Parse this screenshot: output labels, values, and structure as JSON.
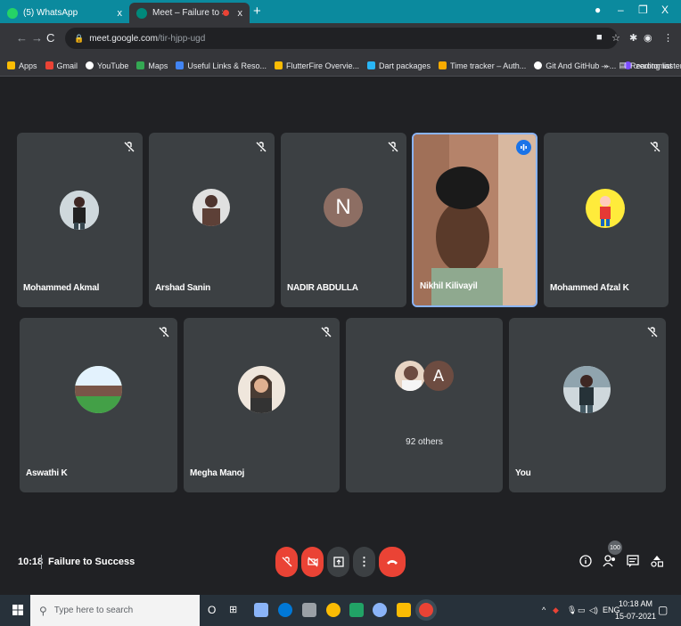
{
  "browser": {
    "tabs": [
      {
        "title": "(5) WhatsApp",
        "close": "x"
      },
      {
        "title": "Meet – Failure to Success",
        "close": "x"
      }
    ],
    "new_tab": "+",
    "url_host": "meet.google.com",
    "url_path": "/tir-hjpp-ugd",
    "bookmarks": [
      {
        "label": "Apps",
        "color": "#fbbc04"
      },
      {
        "label": "Gmail",
        "color": "#ea4335"
      },
      {
        "label": "YouTube",
        "color": "#ffffff"
      },
      {
        "label": "Maps",
        "color": "#34a853"
      },
      {
        "label": "Useful Links & Reso...",
        "color": "#4285f4"
      },
      {
        "label": "FlutterFire Overvie...",
        "color": "#fbbc04"
      },
      {
        "label": "Dart packages",
        "color": "#29b6f6"
      },
      {
        "label": "Time tracker – Auth...",
        "color": "#f9ab00"
      },
      {
        "label": "Git And GitHub —...",
        "color": "#ffffff"
      },
      {
        "label": "zerotomastery.io",
        "color": "#7c4dff"
      }
    ],
    "reading_list": "Reading list",
    "more": "»"
  },
  "meet": {
    "participants": [
      {
        "name": "Mohammed Akmal"
      },
      {
        "name": "Arshad Sanin"
      },
      {
        "name": "NADIR ABDULLA",
        "initial": "N"
      },
      {
        "name": "Nikhil Kilivayil"
      },
      {
        "name": "Mohammed Afzal K"
      },
      {
        "name": "Aswathi K"
      },
      {
        "name": "Megha Manoj"
      },
      {
        "name": "You"
      }
    ],
    "others_initial": "A",
    "others_label": "92 others",
    "time": "10:18",
    "meeting_title": "Failure to Success",
    "participant_count": "100"
  },
  "taskbar": {
    "search_placeholder": "Type here to search",
    "lang": "ENG",
    "time": "10:18 AM",
    "date": "15-07-2021"
  },
  "colors": {
    "tile": "#3c4043",
    "red": "#ea4335",
    "speaking_border": "#8ab4f8"
  }
}
